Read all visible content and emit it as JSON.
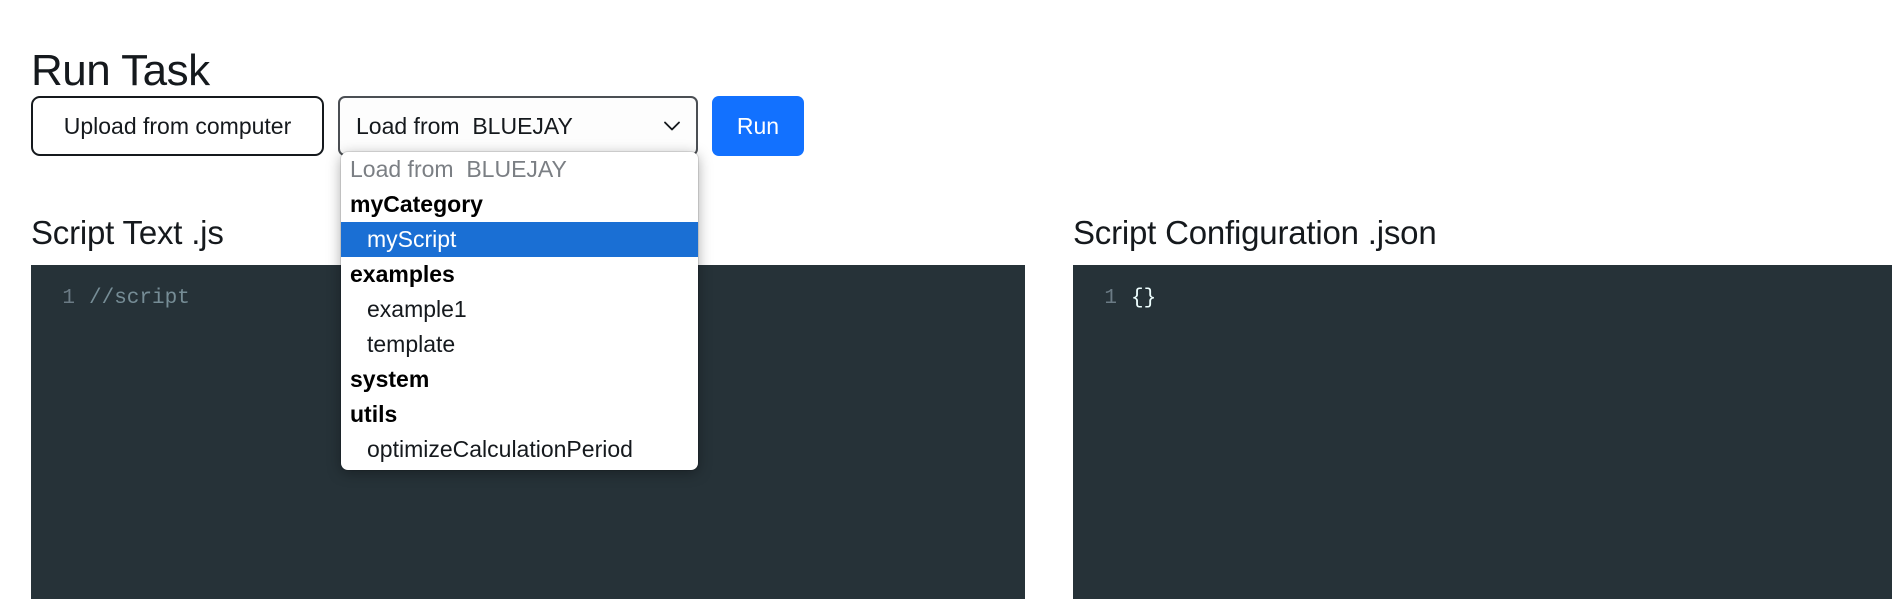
{
  "page": {
    "title": "Run Task"
  },
  "toolbar": {
    "upload_label": "Upload from computer",
    "select_value": "Load from  BLUEJAY",
    "select_chevron_icon": "chevron-down-icon",
    "run_label": "Run",
    "accent_color": "#1271ff"
  },
  "dropdown": {
    "open": true,
    "placeholder": "Load from  BLUEJAY",
    "selected_value": "myScript",
    "highlight_color": "#1a6fd4",
    "groups": [
      {
        "label": "myCategory",
        "options": [
          "myScript"
        ]
      },
      {
        "label": "examples",
        "options": [
          "example1",
          "template"
        ]
      },
      {
        "label": "system",
        "options": []
      },
      {
        "label": "utils",
        "options": [
          "optimizeCalculationPeriod"
        ]
      }
    ]
  },
  "panels": {
    "left": {
      "title": "Script Text .js",
      "editor_bg": "#263238",
      "lines": [
        {
          "number": "1",
          "text": "//script",
          "kind": "comment"
        }
      ]
    },
    "right": {
      "title": "Script Configuration .json",
      "editor_bg": "#263238",
      "lines": [
        {
          "number": "1",
          "text": "{}",
          "kind": "json"
        }
      ]
    }
  }
}
